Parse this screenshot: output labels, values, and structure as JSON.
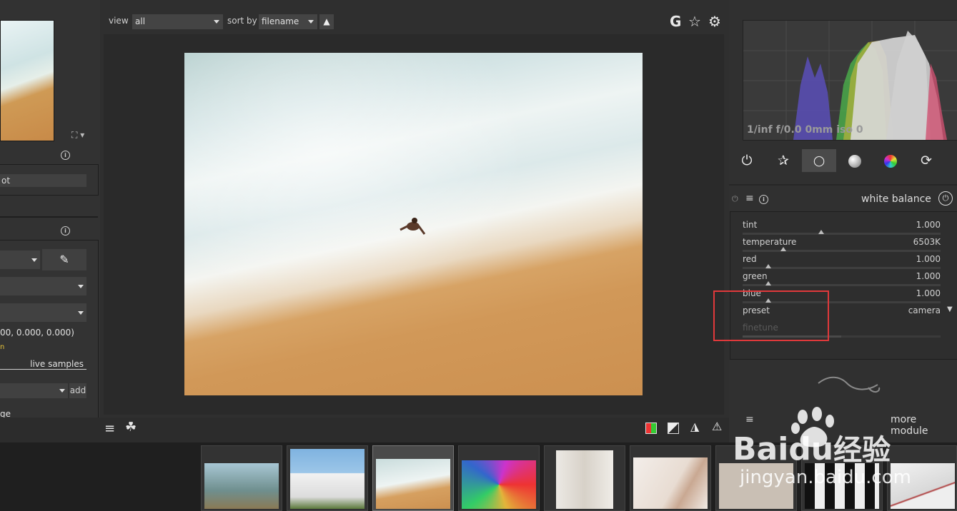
{
  "toolbar": {
    "view_label": "view",
    "view_value": "all",
    "sortby_label": "sort by",
    "sortby_value": "filename",
    "icons": [
      "grouping-icon",
      "star-icon",
      "gear-icon"
    ],
    "grouping_glyph": "G"
  },
  "left": {
    "field1_value": "ot",
    "readout": "00, 0.000, 0.000)",
    "live_samples": "live samples",
    "add_label": "add",
    "trailing_text": "ge",
    "marker_text": "n"
  },
  "histogram": {
    "exif": "1/inf f/0.0 0mm iso 0"
  },
  "module_tabs": [
    "power-icon",
    "favorites-icon",
    "basic-group-icon",
    "tone-group-icon",
    "color-group-icon",
    "correct-group-icon"
  ],
  "white_balance": {
    "title": "white balance",
    "sliders": [
      {
        "label": "tint",
        "value": "1.000"
      },
      {
        "label": "temperature",
        "value": "6503K"
      },
      {
        "label": "red",
        "value": "1.000"
      },
      {
        "label": "green",
        "value": "1.000"
      },
      {
        "label": "blue",
        "value": "1.000"
      }
    ],
    "preset_label": "preset",
    "preset_value": "camera",
    "finetune_label": "finetune"
  },
  "more_modules": "more module",
  "colors": {
    "accent_red": "#e0393b",
    "panel_bg": "#303030"
  },
  "watermark": {
    "brand": "Bai",
    "brand_du": "du",
    "brand_cn": "经验",
    "url": "jingyan.baidu.com"
  }
}
